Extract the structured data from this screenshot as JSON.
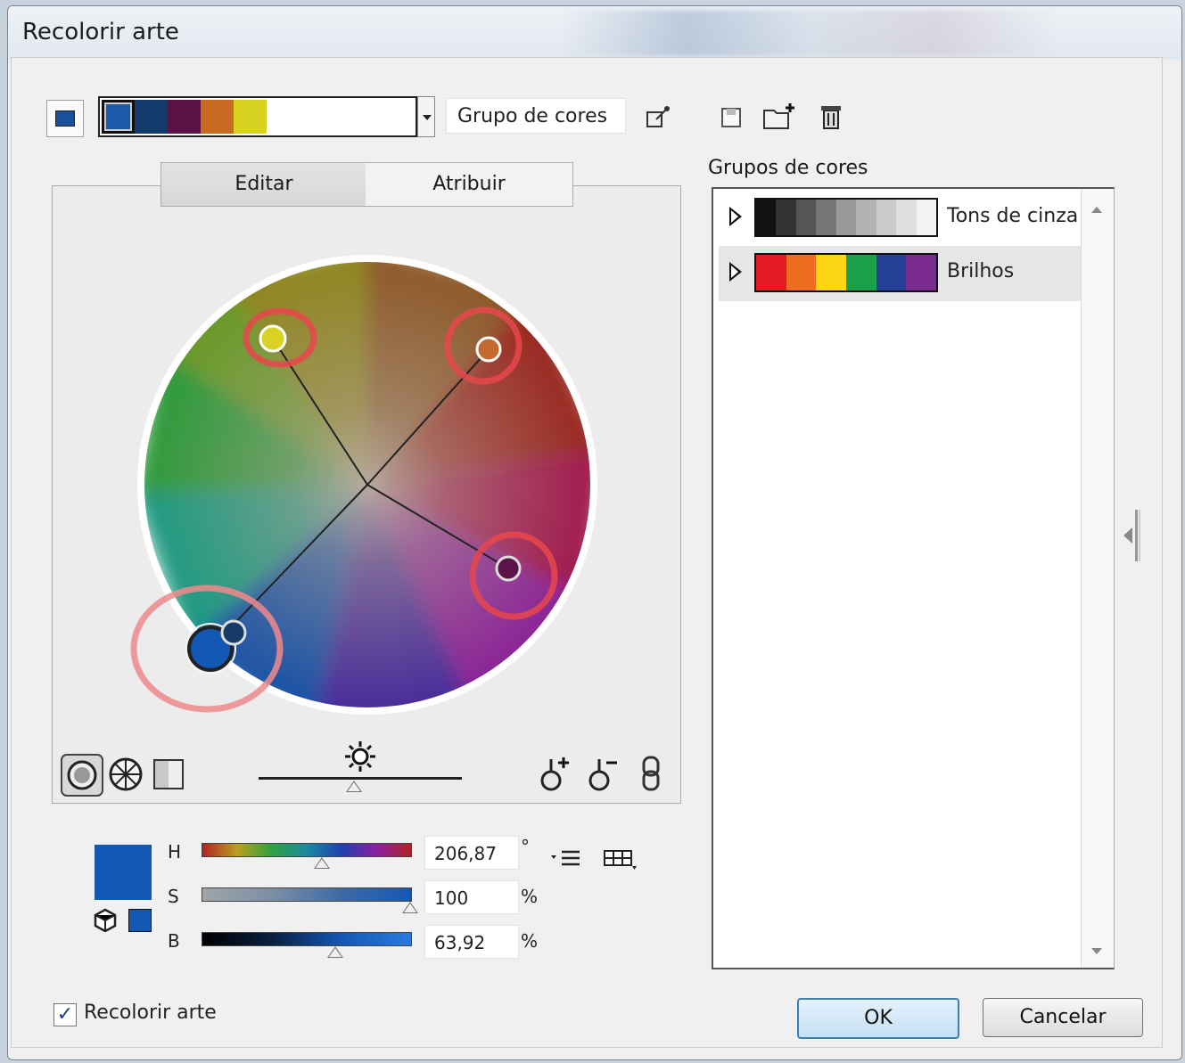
{
  "window": {
    "title": "Recolorir arte"
  },
  "color_strip": {
    "colors": [
      "#1a5aa8",
      "#143a6b",
      "#5a1247",
      "#c96a23",
      "#d7d21f"
    ]
  },
  "group_name": "Grupo de cores",
  "tabs": [
    {
      "label": "Editar"
    },
    {
      "label": "Atribuir"
    }
  ],
  "wheel": {
    "nodes": [
      {
        "name": "yellow",
        "color": "#d8d324"
      },
      {
        "name": "orange",
        "color": "#c46a2e"
      },
      {
        "name": "purple",
        "color": "#5b1449"
      },
      {
        "name": "blue-base",
        "color": "#1458b5"
      },
      {
        "name": "navy",
        "color": "#163a66"
      }
    ]
  },
  "hsb": {
    "h": {
      "label": "H",
      "value": "206,87",
      "unit": "°",
      "level": 0.575
    },
    "s": {
      "label": "S",
      "value": "100",
      "unit": "%",
      "level": 1.0
    },
    "b": {
      "label": "B",
      "value": "63,92",
      "unit": "%",
      "level": 0.6392
    }
  },
  "current_color": "#1458b5",
  "groups_panel": {
    "label": "Grupos de cores",
    "groups": [
      {
        "label": "Tons de cinza",
        "colors": [
          "#111111",
          "#333333",
          "#555555",
          "#777777",
          "#999999",
          "#b3b3b3",
          "#cccccc",
          "#e0e0e0",
          "#f2f2f2"
        ]
      },
      {
        "label": "Brilhos",
        "colors": [
          "#e31b23",
          "#ef6d1f",
          "#fcd615",
          "#1aa04a",
          "#233f96",
          "#7a2d8f"
        ]
      }
    ]
  },
  "footer": {
    "recolor_label": "Recolorir arte",
    "recolor_checked": true,
    "ok_label": "OK",
    "cancel_label": "Cancelar"
  }
}
